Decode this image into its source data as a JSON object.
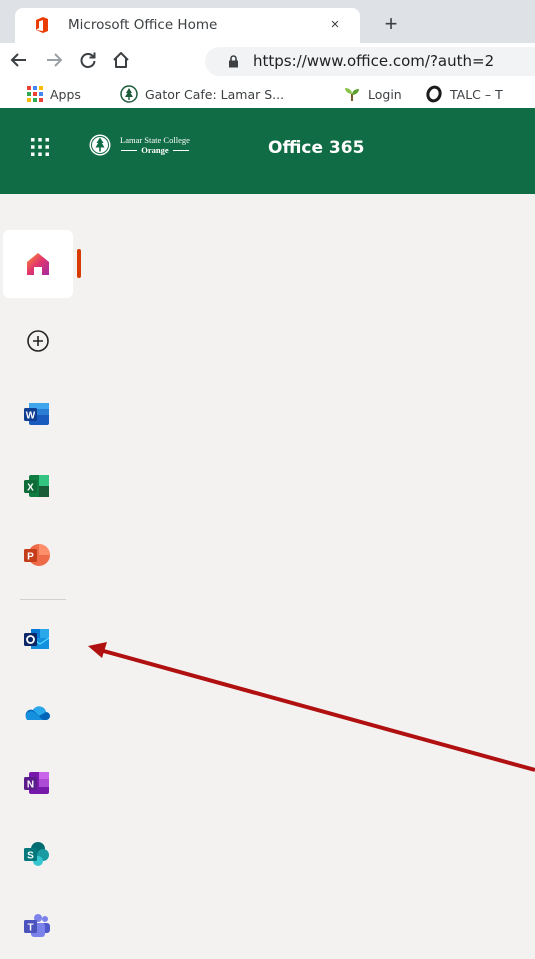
{
  "browser": {
    "tab_title": "Microsoft Office Home",
    "close_glyph": "×",
    "new_tab_glyph": "+",
    "url": "https://www.office.com/?auth=2",
    "bookmarks": [
      {
        "label": "Apps",
        "icon": "apps-grid-icon"
      },
      {
        "label": "Gator Cafe: Lamar S...",
        "icon": "college-seal-icon"
      },
      {
        "label": "Login",
        "icon": "sprout-icon"
      },
      {
        "label": "TALC – T",
        "icon": "talc-o-icon"
      }
    ]
  },
  "office_header": {
    "college_line1": "Lamar State College",
    "college_line2": "Orange",
    "title": "Office 365",
    "color": "#106c45"
  },
  "rail": {
    "items": [
      {
        "name": "home",
        "icon": "home-icon"
      },
      {
        "name": "create",
        "icon": "plus-circle-icon"
      },
      {
        "name": "word",
        "icon": "word-icon",
        "letter": "W"
      },
      {
        "name": "excel",
        "icon": "excel-icon",
        "letter": "X"
      },
      {
        "name": "powerpoint",
        "icon": "powerpoint-icon",
        "letter": "P"
      },
      {
        "name": "outlook",
        "icon": "outlook-icon",
        "letter": "O"
      },
      {
        "name": "onedrive",
        "icon": "onedrive-icon"
      },
      {
        "name": "onenote",
        "icon": "onenote-icon",
        "letter": "N"
      },
      {
        "name": "sharepoint",
        "icon": "sharepoint-icon",
        "letter": "S"
      },
      {
        "name": "teams",
        "icon": "teams-icon",
        "letter": "T"
      }
    ]
  },
  "annotation": {
    "arrow_color": "#b01010"
  }
}
